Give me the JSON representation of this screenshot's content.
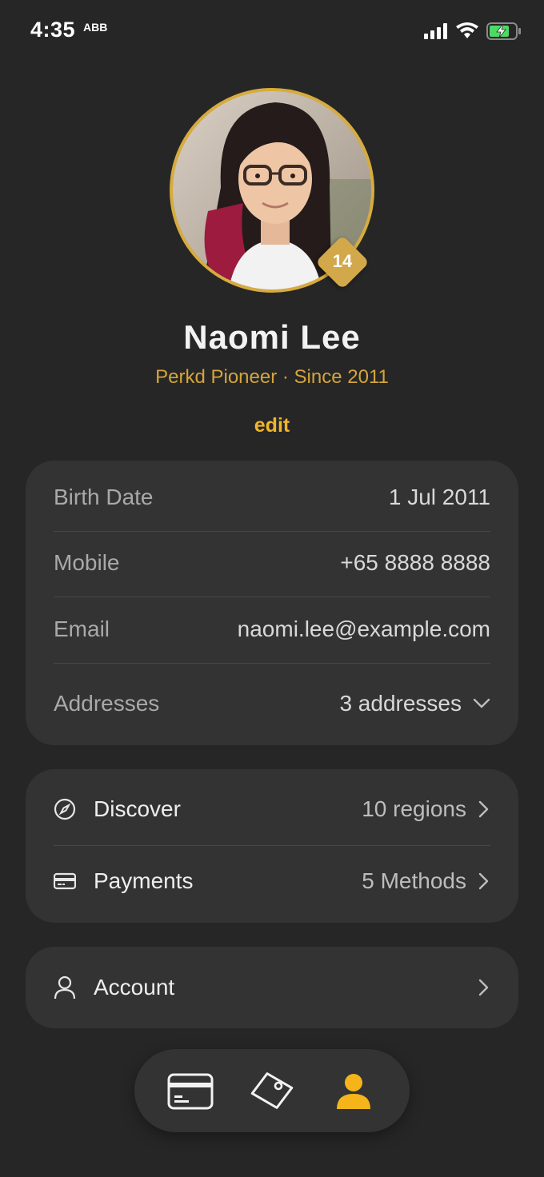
{
  "status_bar": {
    "time": "4:35",
    "extra": "ABB"
  },
  "profile": {
    "name": "Naomi Lee",
    "tier": "Perkd Pioneer · Since 2011",
    "level": "14",
    "edit_label": "edit"
  },
  "details": {
    "rows": [
      {
        "label": "Birth Date",
        "value": "1 Jul 2011"
      },
      {
        "label": "Mobile",
        "value": "+65 8888 8888"
      },
      {
        "label": "Email",
        "value": "naomi.lee@example.com"
      },
      {
        "label": "Addresses",
        "value": "3 addresses"
      }
    ]
  },
  "links": {
    "discover": {
      "label": "Discover",
      "value": "10 regions",
      "icon": "compass-icon"
    },
    "payments": {
      "label": "Payments",
      "value": "5 Methods",
      "icon": "credit-card-icon"
    },
    "account": {
      "label": "Account",
      "icon": "person-icon"
    }
  },
  "tab_bar": {
    "tabs": [
      {
        "name": "cards",
        "icon": "card-icon",
        "active": false
      },
      {
        "name": "offers",
        "icon": "tag-icon",
        "active": false
      },
      {
        "name": "profile",
        "icon": "person-icon",
        "active": true
      }
    ]
  },
  "colors": {
    "background": "#262626",
    "card": "#333333",
    "accent": "#f0b52b",
    "gold": "#d4a53c"
  }
}
